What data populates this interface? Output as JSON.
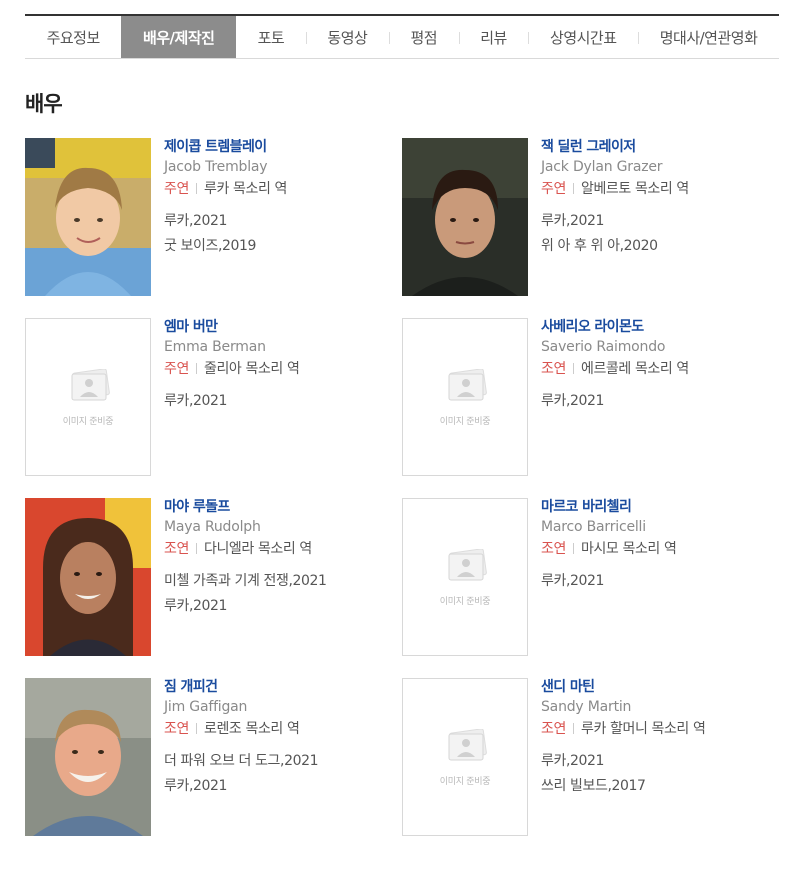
{
  "tabs": [
    {
      "label": "주요정보",
      "active": false
    },
    {
      "label": "배우/제작진",
      "active": true
    },
    {
      "label": "포토",
      "active": false
    },
    {
      "label": "동영상",
      "active": false
    },
    {
      "label": "평점",
      "active": false
    },
    {
      "label": "리뷰",
      "active": false
    },
    {
      "label": "상영시간표",
      "active": false
    },
    {
      "label": "명대사/연관영화",
      "active": false
    }
  ],
  "section_title": "배우",
  "placeholder_text": "이미지 준비중",
  "cast": [
    {
      "name": "제이콥 트렘블레이",
      "name_en": "Jacob Tremblay",
      "type": "주연",
      "role": "루카 목소리 역",
      "films": [
        "루카,2021",
        "굿 보이즈,2019"
      ],
      "photo": "photo"
    },
    {
      "name": "잭 딜런 그레이저",
      "name_en": "Jack Dylan Grazer",
      "type": "주연",
      "role": "알베르토 목소리 역",
      "films": [
        "루카,2021",
        "위 아 후 위 아,2020"
      ],
      "photo": "photo"
    },
    {
      "name": "엠마 버만",
      "name_en": "Emma Berman",
      "type": "주연",
      "role": "줄리아 목소리 역",
      "films": [
        "루카,2021"
      ],
      "photo": "placeholder"
    },
    {
      "name": "사베리오 라이몬도",
      "name_en": "Saverio Raimondo",
      "type": "조연",
      "role": "에르콜레 목소리 역",
      "films": [
        "루카,2021"
      ],
      "photo": "placeholder"
    },
    {
      "name": "마야 루돌프",
      "name_en": "Maya Rudolph",
      "type": "조연",
      "role": "다니엘라 목소리 역",
      "films": [
        "미첼 가족과 기계 전쟁,2021",
        "루카,2021"
      ],
      "photo": "photo"
    },
    {
      "name": "마르코 바리첼리",
      "name_en": "Marco Barricelli",
      "type": "조연",
      "role": "마시모 목소리 역",
      "films": [
        "루카,2021"
      ],
      "photo": "placeholder"
    },
    {
      "name": "짐 개피건",
      "name_en": "Jim Gaffigan",
      "type": "조연",
      "role": "로렌조 목소리 역",
      "films": [
        "더 파워 오브 더 도그,2021",
        "루카,2021"
      ],
      "photo": "photo"
    },
    {
      "name": "샌디 마틴",
      "name_en": "Sandy Martin",
      "type": "조연",
      "role": "루카 할머니 목소리 역",
      "films": [
        "루카,2021",
        "쓰리 빌보드,2017"
      ],
      "photo": "placeholder"
    }
  ]
}
